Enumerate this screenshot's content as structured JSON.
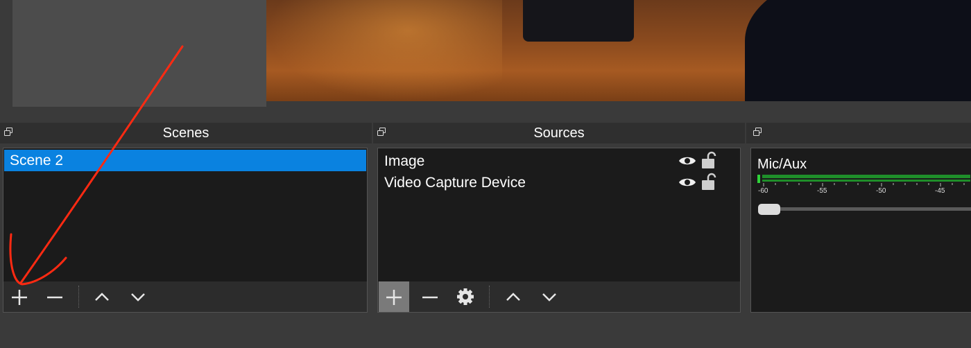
{
  "scenes": {
    "title": "Scenes",
    "items": [
      {
        "label": "Scene 2",
        "selected": true
      }
    ],
    "toolbar": [
      "add-icon",
      "remove-icon",
      "move-up-icon",
      "move-down-icon"
    ]
  },
  "sources": {
    "title": "Sources",
    "items": [
      {
        "label": "Image",
        "visible": true,
        "locked": false
      },
      {
        "label": "Video Capture Device",
        "visible": true,
        "locked": false
      }
    ],
    "toolbar": [
      "add-icon",
      "remove-icon",
      "gear-icon",
      "move-up-icon",
      "move-down-icon"
    ]
  },
  "mixer": {
    "title": "",
    "channel": "Mic/Aux",
    "scale": [
      "-60",
      "-55",
      "-50",
      "-45"
    ],
    "meter_color": "#2fd33a"
  },
  "colors": {
    "selection": "#0a82e0",
    "annotation": "#ff2a12"
  }
}
